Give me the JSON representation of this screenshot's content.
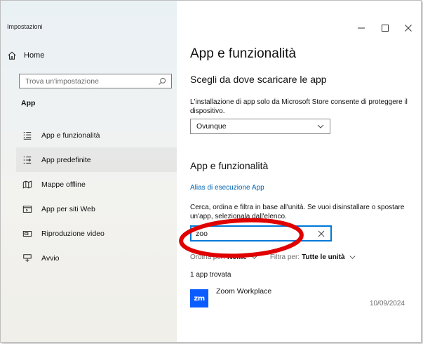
{
  "window": {
    "title": "Impostazioni",
    "controls": {
      "minimize": "–",
      "maximize": "☐",
      "close": "✕"
    }
  },
  "sidebar": {
    "home_label": "Home",
    "search_placeholder": "Trova un'impostazione",
    "section_label": "App",
    "items": [
      {
        "label": "App e funzionalità",
        "icon": "app-list-icon"
      },
      {
        "label": "App predefinite",
        "icon": "default-apps-icon",
        "selected": true
      },
      {
        "label": "Mappe offline",
        "icon": "map-icon"
      },
      {
        "label": "App per siti Web",
        "icon": "web-app-icon"
      },
      {
        "label": "Riproduzione video",
        "icon": "video-icon"
      },
      {
        "label": "Avvio",
        "icon": "startup-icon"
      }
    ]
  },
  "main": {
    "title": "App e funzionalità",
    "source_heading": "Scegli da dove scaricare le app",
    "source_description": "L'installazione di app solo da Microsoft Store consente di proteggere il dispositivo.",
    "source_value": "Ovunque",
    "apps_heading": "App e funzionalità",
    "alias_link": "Alias di esecuzione App",
    "filter_description": "Cerca, ordina e filtra in base all'unità. Se vuoi disinstallare o spostare un'app, selezionala dall'elenco.",
    "filter_value": "zoo",
    "sort_prefix": "Ordina per:",
    "sort_value": "Nome",
    "filter_prefix": "Filtra per:",
    "filter_drive": "Tutte le unità",
    "result_count": "1 app trovata",
    "apps": [
      {
        "name": "Zoom Workplace",
        "date": "10/09/2024",
        "icon_text": "zm"
      }
    ]
  },
  "colors": {
    "accent": "#0078d7",
    "link": "#0063b1",
    "annotation": "#e00000",
    "zoom_brand": "#0b5cff"
  }
}
